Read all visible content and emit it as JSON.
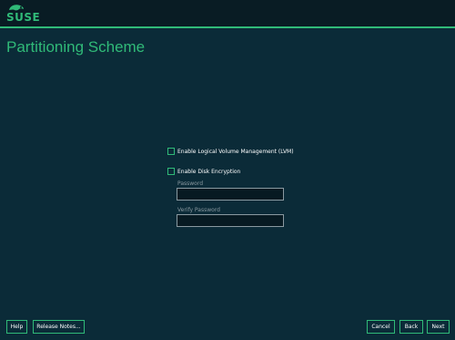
{
  "header": {
    "logo_text": "SUSE"
  },
  "page": {
    "title": "Partitioning Scheme"
  },
  "options": {
    "lvm_label": "Enable Logical Volume Management (LVM)",
    "encryption_label": "Enable Disk Encryption",
    "password_label": "Password",
    "password_value": "",
    "verify_label": "Verify Password",
    "verify_value": ""
  },
  "footer": {
    "help_label": "Help",
    "release_notes_label": "Release Notes...",
    "cancel_label": "Cancel",
    "back_label": "Back",
    "next_label": "Next"
  },
  "colors": {
    "accent": "#30ba78",
    "background": "#0b2b38",
    "topbar": "#091c24"
  },
  "icons": {
    "logo": "suse-chameleon-icon"
  }
}
